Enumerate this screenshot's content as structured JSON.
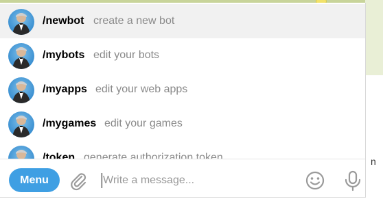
{
  "commands": [
    {
      "name": "/newbot",
      "desc": "create a new bot",
      "selected": true
    },
    {
      "name": "/mybots",
      "desc": "edit your bots",
      "selected": false
    },
    {
      "name": "/myapps",
      "desc": "edit your web apps",
      "selected": false
    },
    {
      "name": "/mygames",
      "desc": "edit your games",
      "selected": false
    },
    {
      "name": "/token",
      "desc": "generate authorization token",
      "selected": false
    }
  ],
  "composer": {
    "menu_label": "Menu",
    "placeholder": "Write a message...",
    "attach_icon": "paperclip-icon",
    "emoji_icon": "smiley-icon",
    "mic_icon": "microphone-icon"
  },
  "colors": {
    "accent": "#3f9fe3",
    "selected_row": "#f1f1f1",
    "desc_text": "#8a8a8a"
  },
  "sliver_text": "n"
}
